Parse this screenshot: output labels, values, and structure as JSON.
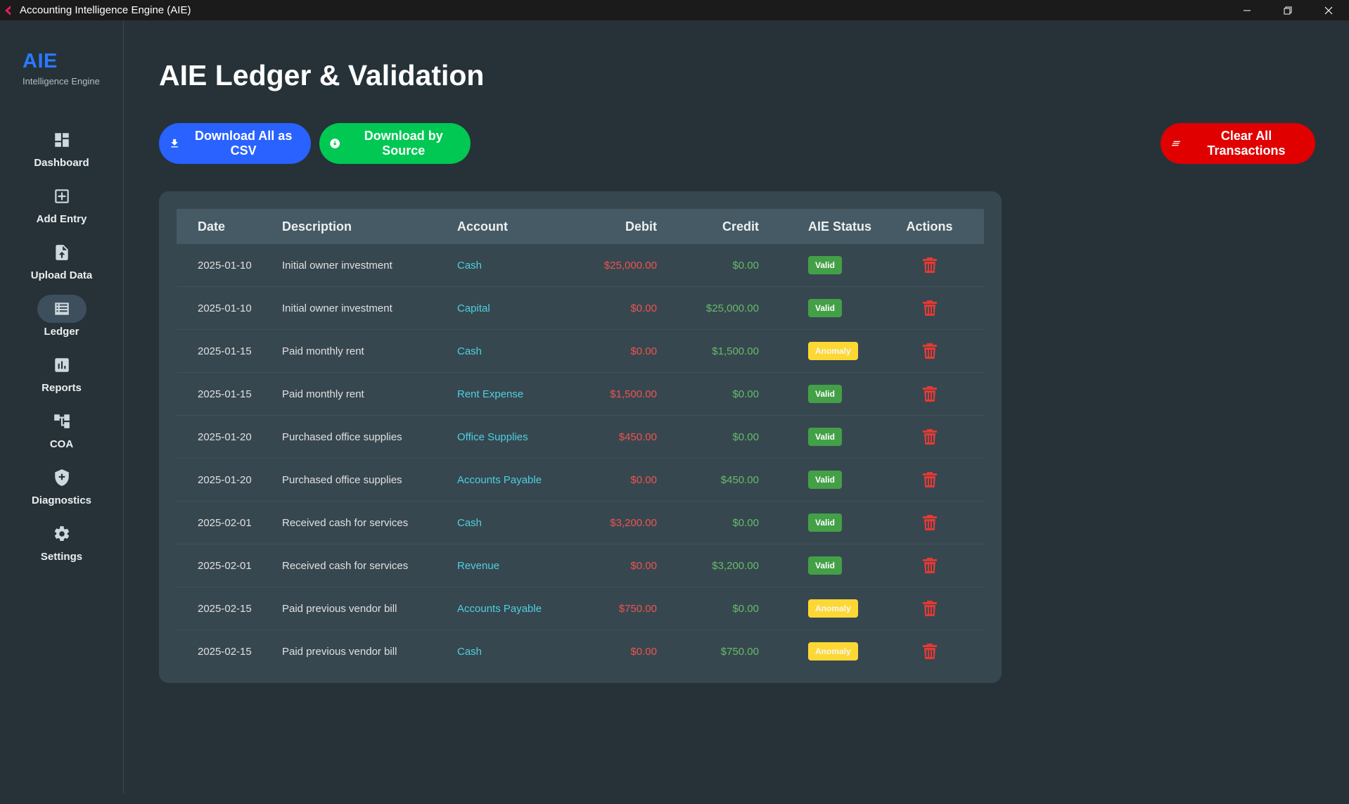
{
  "window": {
    "title": "Accounting Intelligence Engine (AIE)"
  },
  "brand": {
    "title": "AIE",
    "subtitle": "Intelligence Engine"
  },
  "sidebar": {
    "items": [
      {
        "label": "Dashboard",
        "icon": "dashboard-icon"
      },
      {
        "label": "Add Entry",
        "icon": "add-box-icon"
      },
      {
        "label": "Upload Data",
        "icon": "upload-file-icon"
      },
      {
        "label": "Ledger",
        "icon": "list-icon",
        "active": true
      },
      {
        "label": "Reports",
        "icon": "bar-chart-icon"
      },
      {
        "label": "COA",
        "icon": "account-tree-icon"
      },
      {
        "label": "Diagnostics",
        "icon": "shield-icon"
      },
      {
        "label": "Settings",
        "icon": "gear-icon"
      }
    ]
  },
  "main": {
    "title": "AIE Ledger & Validation",
    "buttons": {
      "download_csv": "Download All as CSV",
      "download_source": "Download by Source",
      "clear_all": "Clear All Transactions"
    }
  },
  "ledger": {
    "columns": [
      "Date",
      "Description",
      "Account",
      "Debit",
      "Credit",
      "AIE Status",
      "Actions"
    ],
    "rows": [
      {
        "date": "2025-01-10",
        "description": "Initial owner investment",
        "account": "Cash",
        "debit": "$25,000.00",
        "credit": "$0.00",
        "status": "Valid"
      },
      {
        "date": "2025-01-10",
        "description": "Initial owner investment",
        "account": "Capital",
        "debit": "$0.00",
        "credit": "$25,000.00",
        "status": "Valid"
      },
      {
        "date": "2025-01-15",
        "description": "Paid monthly rent",
        "account": "Cash",
        "debit": "$0.00",
        "credit": "$1,500.00",
        "status": "Anomaly"
      },
      {
        "date": "2025-01-15",
        "description": "Paid monthly rent",
        "account": "Rent Expense",
        "debit": "$1,500.00",
        "credit": "$0.00",
        "status": "Valid"
      },
      {
        "date": "2025-01-20",
        "description": "Purchased office supplies",
        "account": "Office Supplies",
        "debit": "$450.00",
        "credit": "$0.00",
        "status": "Valid"
      },
      {
        "date": "2025-01-20",
        "description": "Purchased office supplies",
        "account": "Accounts Payable",
        "debit": "$0.00",
        "credit": "$450.00",
        "status": "Valid"
      },
      {
        "date": "2025-02-01",
        "description": "Received cash for services",
        "account": "Cash",
        "debit": "$3,200.00",
        "credit": "$0.00",
        "status": "Valid"
      },
      {
        "date": "2025-02-01",
        "description": "Received cash for services",
        "account": "Revenue",
        "debit": "$0.00",
        "credit": "$3,200.00",
        "status": "Valid"
      },
      {
        "date": "2025-02-15",
        "description": "Paid previous vendor bill",
        "account": "Accounts Payable",
        "debit": "$750.00",
        "credit": "$0.00",
        "status": "Anomaly"
      },
      {
        "date": "2025-02-15",
        "description": "Paid previous vendor bill",
        "account": "Cash",
        "debit": "$0.00",
        "credit": "$750.00",
        "status": "Anomaly"
      }
    ]
  },
  "colors": {
    "background": "#263238",
    "card": "#37474f",
    "header_row": "#455a64",
    "brand": "#2979ff",
    "csv_button": "#2962ff",
    "source_button": "#00c853",
    "clear_button": "#e00000",
    "debit_text": "#ef5350",
    "credit_text": "#66bb6a",
    "account_text": "#4dd0e1",
    "valid_badge": "#43a047",
    "anomaly_badge": "#fdd835"
  }
}
